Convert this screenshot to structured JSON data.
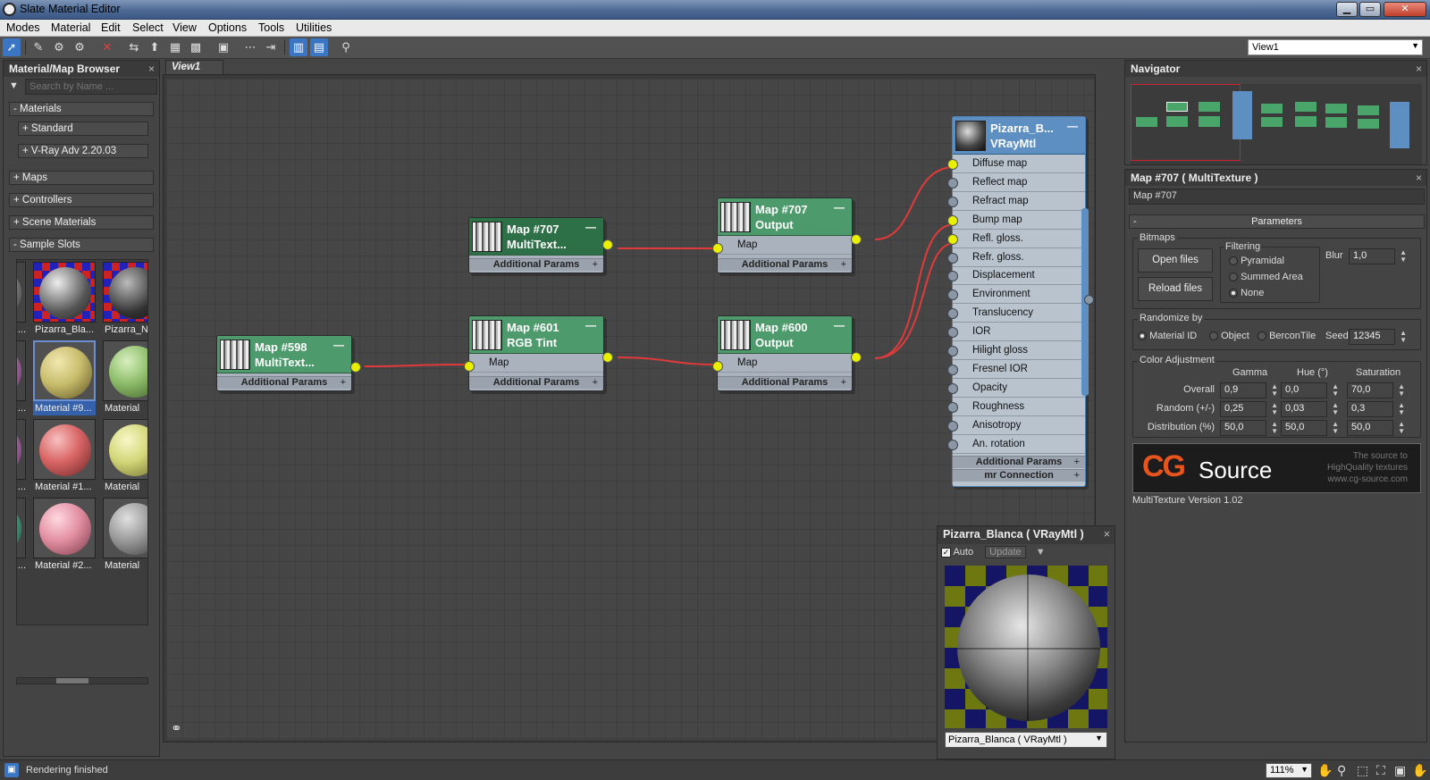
{
  "window": {
    "title": "Slate Material Editor"
  },
  "menu": [
    "Modes",
    "Material",
    "Edit",
    "Select",
    "View",
    "Options",
    "Tools",
    "Utilities"
  ],
  "toolbar": {
    "view_select": "View1"
  },
  "browser": {
    "title": "Material/Map Browser",
    "search_placeholder": "Search by Name ...",
    "rollouts": {
      "materials": "- Materials",
      "standard": "+ Standard",
      "vray": "+ V-Ray Adv 2.20.03",
      "maps": "+ Maps",
      "controllers": "+ Controllers",
      "scene_materials": "+ Scene Materials",
      "sample_slots": "- Sample Slots"
    },
    "slots": [
      {
        "label": "Pizarra_Bla...",
        "type": "tex"
      },
      {
        "label": "Pizarra_N",
        "type": "tex"
      },
      {
        "label": "Material #9...",
        "type": "sphere",
        "color": "#c9bd6d",
        "selected": true
      },
      {
        "label": "Material",
        "type": "sphere",
        "color": "#8ebd6a"
      },
      {
        "label": "Material #1...",
        "type": "sphere",
        "color": "#d96565"
      },
      {
        "label": "Material",
        "type": "sphere",
        "color": "#d3d678"
      },
      {
        "label": "Material #2...",
        "type": "sphere",
        "color": "#e390a2"
      },
      {
        "label": "Material",
        "type": "sphere",
        "color": "#9a9a9a"
      }
    ],
    "left_cut_label": "..."
  },
  "view": {
    "tab": "View1"
  },
  "nodes": {
    "n707m": {
      "title1": "Map #707",
      "title2": "MultiText...",
      "foot": "Additional Params"
    },
    "n707o": {
      "title1": "Map #707",
      "title2": "Output",
      "slot": "Map",
      "foot": "Additional Params"
    },
    "n598": {
      "title1": "Map #598",
      "title2": "MultiText...",
      "foot": "Additional Params"
    },
    "n601": {
      "title1": "Map #601",
      "title2": "RGB Tint",
      "slot": "Map",
      "foot": "Additional Params"
    },
    "n600": {
      "title1": "Map #600",
      "title2": "Output",
      "slot": "Map",
      "foot": "Additional Params"
    },
    "vray": {
      "title1": "Pizarra_B...",
      "title2": "VRayMtl",
      "slots": [
        "Diffuse map",
        "Reflect map",
        "Refract map",
        "Bump map",
        "Refl. gloss.",
        "Refr. gloss.",
        "Displacement",
        "Environment",
        "Translucency",
        "IOR",
        "Hilight gloss",
        "Fresnel IOR",
        "Opacity",
        "Roughness",
        "Anisotropy",
        "An. rotation"
      ],
      "connected": [
        0,
        3,
        4
      ],
      "foot1": "Additional Params",
      "foot2": "mr Connection"
    }
  },
  "preview": {
    "title": "Pizarra_Blanca  ( VRayMtl )",
    "auto": "Auto",
    "update": "Update",
    "select": "Pizarra_Blanca  ( VRayMtl )"
  },
  "navigator": {
    "title": "Navigator"
  },
  "params": {
    "title": "Map #707  ( MultiTexture )",
    "name_field": "Map #707",
    "rollout": "Parameters",
    "bitmaps": "Bitmaps",
    "open_files": "Open files",
    "reload_files": "Reload files",
    "filtering": "Filtering",
    "filter_options": [
      "Pyramidal",
      "Summed Area",
      "None"
    ],
    "blur_label": "Blur",
    "blur": "1,0",
    "randomize_by": "Randomize by",
    "rand_options": [
      "Material ID",
      "Object",
      "BerconTile"
    ],
    "seed_label": "Seed",
    "seed": "12345",
    "color_adjust": "Color Adjustment",
    "col_headers": [
      "Gamma",
      "Hue (°)",
      "Saturation"
    ],
    "rows": [
      {
        "label": "Overall",
        "values": [
          "0,9",
          "0,0",
          "70,0"
        ]
      },
      {
        "label": "Random (+/-)",
        "values": [
          "0,25",
          "0,03",
          "0,3"
        ]
      },
      {
        "label": "Distribution (%)",
        "values": [
          "50,0",
          "50,0",
          "50,0"
        ]
      }
    ],
    "banner": {
      "brand_cg": "CG",
      "brand_source": "Source",
      "tag1": "The source to",
      "tag2": "HighQuality textures",
      "url": "www.cg-source.com"
    },
    "version": "MultiTexture Version 1.02"
  },
  "status": {
    "text": "Rendering finished",
    "zoom": "111%"
  }
}
